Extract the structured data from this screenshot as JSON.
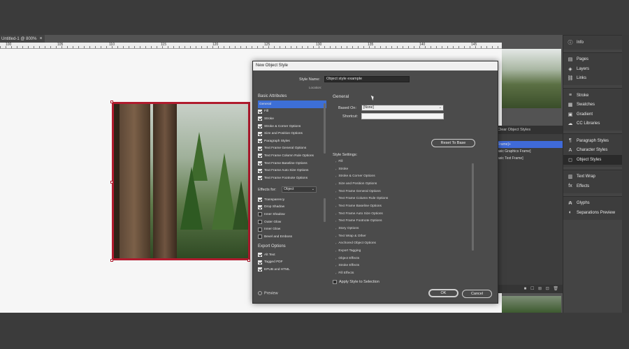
{
  "document_tab": {
    "title": "Untitled-1 @ 800%",
    "close": "×"
  },
  "ruler": {
    "ticks": [
      "100",
      "105",
      "110",
      "115",
      "120",
      "125",
      "130",
      "135",
      "140",
      "145"
    ]
  },
  "dialog": {
    "title": "New Object Style",
    "style_name_label": "Style Name:",
    "style_name_value": "Object style example",
    "location_label": "Location:",
    "basic_attributes_label": "Basic Attributes",
    "basic_attributes": [
      {
        "label": "General",
        "checkbox": false,
        "selected": true
      },
      {
        "label": "Fill",
        "checkbox": true,
        "checked": true
      },
      {
        "label": "Stroke",
        "checkbox": true,
        "checked": true
      },
      {
        "label": "Stroke & Corner Options",
        "checkbox": true,
        "checked": true
      },
      {
        "label": "Size and Position Options",
        "checkbox": true,
        "checked": true
      },
      {
        "label": "Paragraph Styles",
        "checkbox": true,
        "checked": true
      },
      {
        "label": "Text Frame General Options",
        "checkbox": true,
        "checked": true
      },
      {
        "label": "Text Frame Column Rule Options",
        "checkbox": true,
        "checked": true
      },
      {
        "label": "Text Frame Baseline Options",
        "checkbox": true,
        "checked": true
      },
      {
        "label": "Text Frame Auto Size Options",
        "checkbox": true,
        "checked": true
      },
      {
        "label": "Text Frame Footnote Options",
        "checkbox": true,
        "checked": true
      }
    ],
    "effects_for_label": "Effects for:",
    "effects_for_value": "Object",
    "effects": [
      {
        "label": "Transparency",
        "checked": true
      },
      {
        "label": "Drop Shadow",
        "checked": true
      },
      {
        "label": "Inner Shadow",
        "checked": false
      },
      {
        "label": "Outer Glow",
        "checked": false
      },
      {
        "label": "Inner Glow",
        "checked": false
      },
      {
        "label": "Bevel and Emboss",
        "checked": false
      }
    ],
    "export_options_label": "Export Options",
    "export_options": [
      {
        "label": "Alt Text",
        "checked": true
      },
      {
        "label": "Tagged PDF",
        "checked": true
      },
      {
        "label": "EPUB and HTML",
        "checked": true
      }
    ],
    "preview_label": "Preview",
    "general_heading": "General",
    "based_on_label": "Based On:",
    "based_on_value": "[None]",
    "shortcut_label": "Shortcut:",
    "shortcut_value": "",
    "reset_button": "Reset To Base",
    "style_settings_label": "Style Settings:",
    "style_settings": [
      "Fill",
      "Stroke",
      "Stroke & Corner Options",
      "Size and Position Options",
      "Text Frame General Options",
      "Text Frame Column Rule Options",
      "Text Frame Baseline Options",
      "Text Frame Auto Size Options",
      "Text Frame Footnote Options",
      "Story Options",
      "Text Wrap & Other",
      "Anchored Object Options",
      "Export Tagging",
      "Object Effects",
      "Stroke Effects",
      "Fill Effects"
    ],
    "apply_label": "Apply Style to Selection",
    "ok_button": "OK",
    "cancel_button": "Cancel"
  },
  "object_styles_panel": {
    "tabs": "Clear   Object Styles",
    "rows": [
      {
        "label": "",
        "selected": false
      },
      {
        "label": "Frame]+",
        "selected": true
      },
      {
        "label": "asic Graphics Frame]",
        "selected": false
      },
      {
        "label": "asic Text Frame]",
        "selected": false
      }
    ],
    "footer": "■ ☐ ⊞ ⊡ 🗑"
  },
  "dock": {
    "groups": [
      [
        {
          "icon": "ⓘ",
          "label": "Info"
        }
      ],
      [
        {
          "icon": "▤",
          "label": "Pages"
        },
        {
          "icon": "◈",
          "label": "Layers"
        },
        {
          "icon": "⛓",
          "label": "Links"
        }
      ],
      [
        {
          "icon": "≡",
          "label": "Stroke"
        },
        {
          "icon": "▦",
          "label": "Swatches"
        },
        {
          "icon": "▣",
          "label": "Gradient"
        },
        {
          "icon": "☁",
          "label": "CC Libraries"
        }
      ],
      [
        {
          "icon": "¶",
          "label": "Paragraph Styles"
        },
        {
          "icon": "A",
          "label": "Character Styles"
        },
        {
          "icon": "◻",
          "label": "Object Styles",
          "active": true
        }
      ],
      [
        {
          "icon": "▥",
          "label": "Text Wrap"
        },
        {
          "icon": "fx",
          "label": "Effects"
        }
      ],
      [
        {
          "icon": "₳",
          "label": "Glyphs"
        },
        {
          "icon": "◐",
          "label": "Separations Preview"
        }
      ]
    ]
  },
  "colors": {
    "frame_border": "#b01b2e",
    "selection_blue": "#3d6fd6",
    "dialog_bg": "#4b4b4b"
  }
}
